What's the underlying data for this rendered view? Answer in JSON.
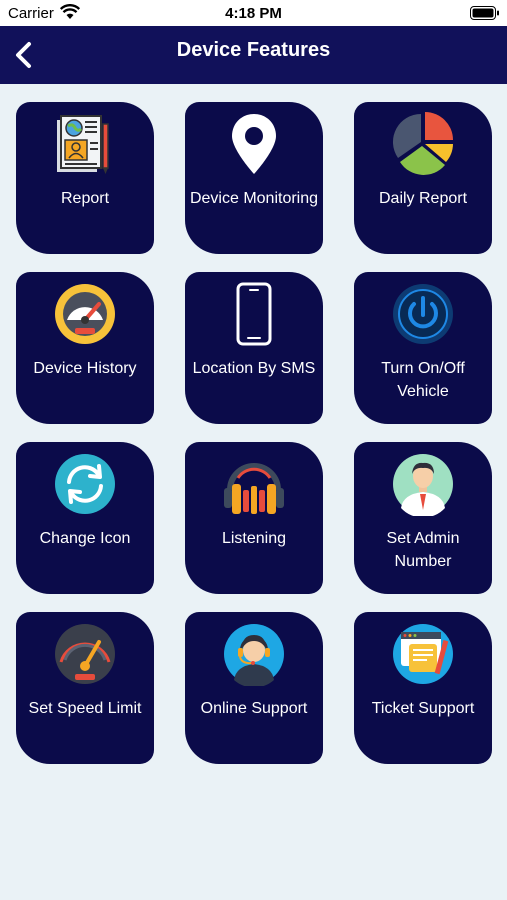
{
  "status_bar": {
    "carrier": "Carrier",
    "time": "4:18 PM"
  },
  "header": {
    "title": "Device Features"
  },
  "features": [
    {
      "label": "Report",
      "icon": "report-icon"
    },
    {
      "label": "Device Monitoring",
      "icon": "map-pin-icon"
    },
    {
      "label": "Daily Report",
      "icon": "pie-chart-icon"
    },
    {
      "label": "Device History",
      "icon": "gauge-icon"
    },
    {
      "label": "Location By SMS",
      "icon": "smartphone-icon"
    },
    {
      "label": "Turn On/Off Vehicle",
      "icon": "power-icon"
    },
    {
      "label": "Change Icon",
      "icon": "refresh-icon"
    },
    {
      "label": "Listening",
      "icon": "headphones-icon"
    },
    {
      "label": "Set Admin Number",
      "icon": "admin-avatar-icon"
    },
    {
      "label": "Set Speed Limit",
      "icon": "speedometer-icon"
    },
    {
      "label": "Online Support",
      "icon": "support-agent-icon"
    },
    {
      "label": "Ticket Support",
      "icon": "ticket-support-icon"
    }
  ],
  "colors": {
    "nav": "#11115a",
    "tile": "#0b0b4a",
    "background": "#eaf2f6"
  }
}
